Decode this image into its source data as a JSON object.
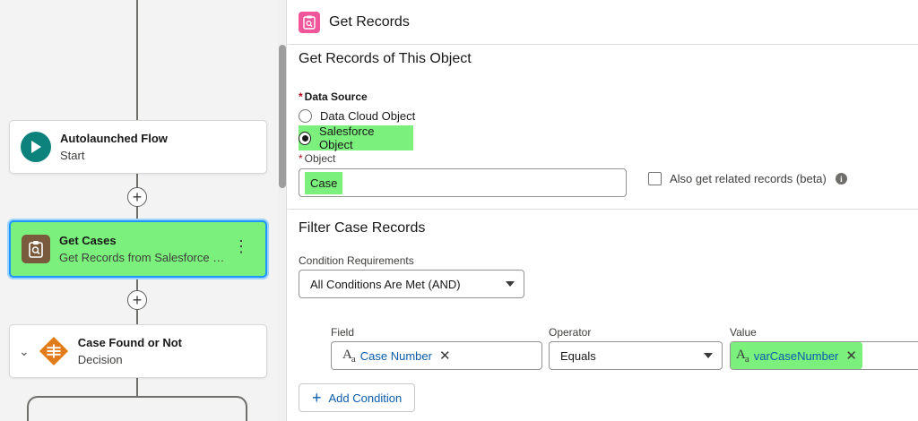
{
  "canvas": {
    "nodes": [
      {
        "title": "Autolaunched Flow",
        "subtitle": "Start"
      },
      {
        "title": "Get Cases",
        "subtitle": "Get Records from Salesforce C..."
      },
      {
        "title": "Case Found or Not",
        "subtitle": "Decision"
      }
    ],
    "add_symbol": "+",
    "kebab_symbol": "⋮",
    "chevron_symbol": "⌄"
  },
  "panel": {
    "header_title": "Get Records",
    "object_section_title": "Get Records of This Object",
    "data_source": {
      "required_marker": "*",
      "label": "Data Source",
      "options": [
        {
          "label": "Data Cloud Object",
          "selected": false
        },
        {
          "label": "Salesforce Object",
          "selected": true
        }
      ]
    },
    "object_field": {
      "required_marker": "*",
      "label": "Object",
      "value": "Case"
    },
    "related_records": {
      "label": "Also get related records (beta)",
      "checked": false,
      "info_symbol": "i"
    },
    "filter_section_title": "Filter Case Records",
    "condition_requirements": {
      "label": "Condition Requirements",
      "value": "All Conditions Are Met (AND)"
    },
    "condition_row": {
      "field_label": "Field",
      "field_value": "Case Number",
      "operator_label": "Operator",
      "operator_value": "Equals",
      "value_label": "Value",
      "value_value": "varCaseNumber",
      "remove_symbol": "✕",
      "text_type_icon_main": "A",
      "text_type_icon_sub": "a"
    },
    "add_condition_label": "Add Condition",
    "add_condition_symbol": "+"
  },
  "colors": {
    "highlight": "#7cf07c",
    "start_icon": "#0b827c",
    "get_records_icon": "#7a5a3c",
    "decision_icon": "#e07d1a",
    "header_icon": "#f2569a",
    "link": "#0b5cab",
    "selection_border": "#1b96ff"
  },
  "icons": {
    "start": "play-icon",
    "get_records": "get-records-icon",
    "decision": "decision-icon",
    "header": "get-records-icon",
    "info": "info-icon"
  }
}
